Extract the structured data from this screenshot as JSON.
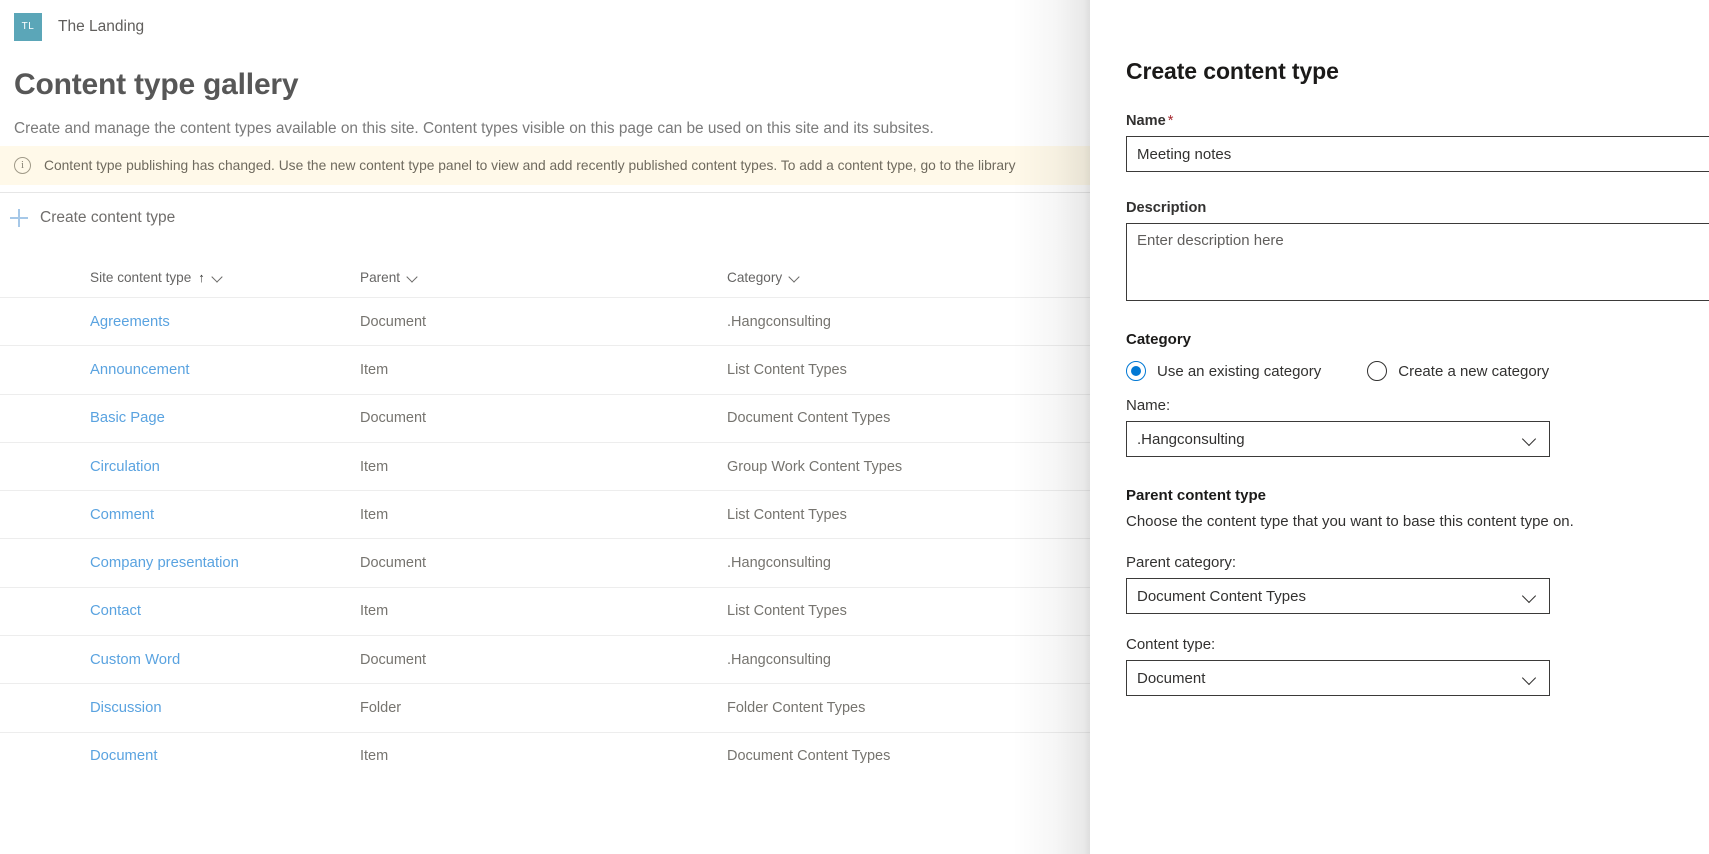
{
  "site": {
    "logo_initials": "TL",
    "name": "The Landing"
  },
  "page": {
    "title": "Content type gallery",
    "description": "Create and manage the content types available on this site. Content types visible on this page can be used on this site and its subsites.",
    "notice": {
      "icon": "info-icon",
      "text": "Content type publishing has changed. Use the new content type panel to view and add recently published content types. To add a content type, go to the library"
    },
    "command_bar": {
      "create_label": "Create content type",
      "icon": "plus-icon"
    }
  },
  "table": {
    "columns": [
      {
        "label": "Site content type",
        "sorted": "ascending",
        "sort_glyph": "↑"
      },
      {
        "label": "Parent"
      },
      {
        "label": "Category"
      }
    ],
    "rows": [
      {
        "name": "Agreements",
        "parent": "Document",
        "category": ".Hangconsulting"
      },
      {
        "name": "Announcement",
        "parent": "Item",
        "category": "List Content Types"
      },
      {
        "name": "Basic Page",
        "parent": "Document",
        "category": "Document Content Types"
      },
      {
        "name": "Circulation",
        "parent": "Item",
        "category": "Group Work Content Types"
      },
      {
        "name": "Comment",
        "parent": "Item",
        "category": "List Content Types"
      },
      {
        "name": "Company presentation",
        "parent": "Document",
        "category": ".Hangconsulting"
      },
      {
        "name": "Contact",
        "parent": "Item",
        "category": "List Content Types"
      },
      {
        "name": "Custom Word",
        "parent": "Document",
        "category": ".Hangconsulting"
      },
      {
        "name": "Discussion",
        "parent": "Folder",
        "category": "Folder Content Types"
      },
      {
        "name": "Document",
        "parent": "Item",
        "category": "Document Content Types"
      }
    ]
  },
  "panel": {
    "title": "Create content type",
    "name_field": {
      "label": "Name",
      "required_mark": "*",
      "value": "Meeting notes"
    },
    "description_field": {
      "label": "Description",
      "placeholder": "Enter description here",
      "value": ""
    },
    "category_section": {
      "heading": "Category",
      "options": [
        {
          "label": "Use an existing category",
          "selected": true
        },
        {
          "label": "Create a new category",
          "selected": false
        }
      ],
      "name_label": "Name:",
      "name_value": ".Hangconsulting",
      "chevron": "chevron-down-icon"
    },
    "parent_section": {
      "heading": "Parent content type",
      "description": "Choose the content type that you want to base this content type on.",
      "parent_category_label": "Parent category:",
      "parent_category_value": "Document Content Types",
      "content_type_label": "Content type:",
      "content_type_value": "Document"
    }
  },
  "colors": {
    "accent": "#0078d4",
    "link": "#5aa3e0",
    "notice_bg": "#FFF9E9",
    "logo_bg": "#5BA6B8",
    "required": "#a4262c"
  }
}
